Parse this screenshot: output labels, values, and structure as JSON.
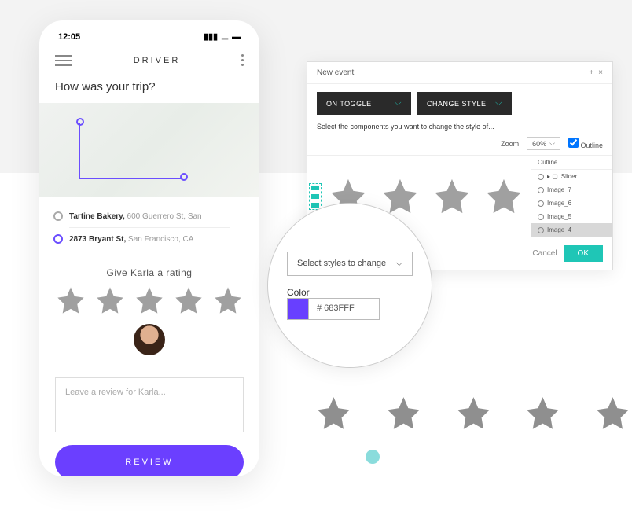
{
  "phone": {
    "status_time": "12:05",
    "header_title": "DRIVER",
    "question": "How was your trip?",
    "origin_name": "Tartine Bakery,",
    "origin_addr": " 600 Guerrero St, San",
    "dest_name": "2873 Bryant St,",
    "dest_addr": " San Francisco, CA",
    "rating_title": "Give Karla a rating",
    "review_placeholder": "Leave a review for Karla...",
    "review_button": "REVIEW"
  },
  "panel": {
    "title": "New event",
    "trigger": "ON TOGGLE",
    "action": "CHANGE STYLE",
    "instruction": "Select the components you want to change the style of...",
    "zoom_label": "Zoom",
    "zoom_value": "60%",
    "outline_checkbox": "Outline",
    "outline_title": "Outline",
    "outline_items": [
      "Slider",
      "Image_7",
      "Image_6",
      "Image_5",
      "Image_4"
    ],
    "cancel": "Cancel",
    "ok": "OK"
  },
  "magnifier": {
    "select_label": "Select styles to change",
    "color_label": "Color",
    "color_value": "# 683FFF"
  },
  "colors": {
    "accent": "#683FFF",
    "teal": "#1fc6b6",
    "star": "#a0a0a0"
  }
}
